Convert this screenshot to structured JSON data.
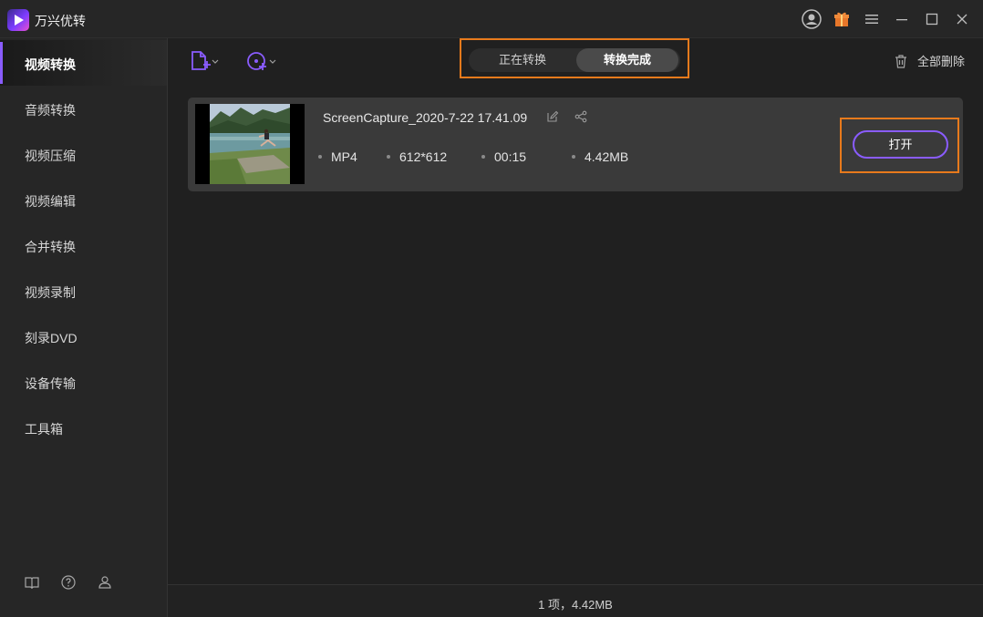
{
  "app": {
    "title": "万兴优转"
  },
  "sidebar": {
    "items": [
      {
        "label": "视频转换",
        "active": true
      },
      {
        "label": "音频转换"
      },
      {
        "label": "视频压缩"
      },
      {
        "label": "视频编辑"
      },
      {
        "label": "合并转换"
      },
      {
        "label": "视频录制"
      },
      {
        "label": "刻录DVD"
      },
      {
        "label": "设备传输"
      },
      {
        "label": "工具箱"
      }
    ],
    "bottom_icons": [
      "book-icon",
      "help-icon",
      "user-group-icon"
    ]
  },
  "toolbar": {
    "tabs": [
      {
        "label": "正在转换"
      },
      {
        "label": "转换完成",
        "selected": true
      }
    ],
    "delete_all_label": "全部删除"
  },
  "file": {
    "name": "ScreenCapture_2020-7-22 17.41.09",
    "format": "MP4",
    "resolution": "612*612",
    "duration": "00:15",
    "size": "4.42MB",
    "open_label": "打开"
  },
  "status": {
    "summary": "1 项，4.42MB"
  },
  "colors": {
    "accent": "#8a5cff",
    "highlight": "#e87a1c"
  }
}
